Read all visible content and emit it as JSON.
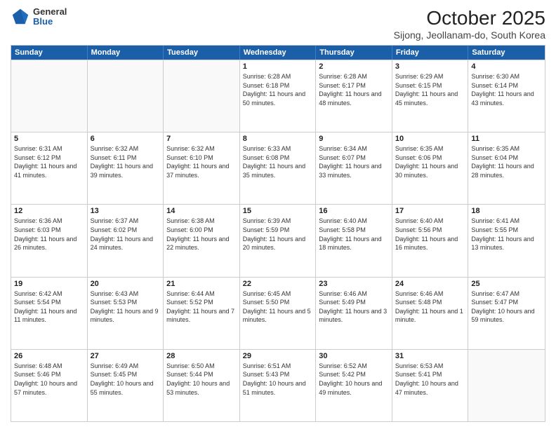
{
  "header": {
    "logo_general": "General",
    "logo_blue": "Blue",
    "title": "October 2025",
    "subtitle": "Sijong, Jeollanam-do, South Korea"
  },
  "weekdays": [
    "Sunday",
    "Monday",
    "Tuesday",
    "Wednesday",
    "Thursday",
    "Friday",
    "Saturday"
  ],
  "weeks": [
    [
      {
        "day": "",
        "sunrise": "",
        "sunset": "",
        "daylight": ""
      },
      {
        "day": "",
        "sunrise": "",
        "sunset": "",
        "daylight": ""
      },
      {
        "day": "",
        "sunrise": "",
        "sunset": "",
        "daylight": ""
      },
      {
        "day": "1",
        "sunrise": "Sunrise: 6:28 AM",
        "sunset": "Sunset: 6:18 PM",
        "daylight": "Daylight: 11 hours and 50 minutes."
      },
      {
        "day": "2",
        "sunrise": "Sunrise: 6:28 AM",
        "sunset": "Sunset: 6:17 PM",
        "daylight": "Daylight: 11 hours and 48 minutes."
      },
      {
        "day": "3",
        "sunrise": "Sunrise: 6:29 AM",
        "sunset": "Sunset: 6:15 PM",
        "daylight": "Daylight: 11 hours and 45 minutes."
      },
      {
        "day": "4",
        "sunrise": "Sunrise: 6:30 AM",
        "sunset": "Sunset: 6:14 PM",
        "daylight": "Daylight: 11 hours and 43 minutes."
      }
    ],
    [
      {
        "day": "5",
        "sunrise": "Sunrise: 6:31 AM",
        "sunset": "Sunset: 6:12 PM",
        "daylight": "Daylight: 11 hours and 41 minutes."
      },
      {
        "day": "6",
        "sunrise": "Sunrise: 6:32 AM",
        "sunset": "Sunset: 6:11 PM",
        "daylight": "Daylight: 11 hours and 39 minutes."
      },
      {
        "day": "7",
        "sunrise": "Sunrise: 6:32 AM",
        "sunset": "Sunset: 6:10 PM",
        "daylight": "Daylight: 11 hours and 37 minutes."
      },
      {
        "day": "8",
        "sunrise": "Sunrise: 6:33 AM",
        "sunset": "Sunset: 6:08 PM",
        "daylight": "Daylight: 11 hours and 35 minutes."
      },
      {
        "day": "9",
        "sunrise": "Sunrise: 6:34 AM",
        "sunset": "Sunset: 6:07 PM",
        "daylight": "Daylight: 11 hours and 33 minutes."
      },
      {
        "day": "10",
        "sunrise": "Sunrise: 6:35 AM",
        "sunset": "Sunset: 6:06 PM",
        "daylight": "Daylight: 11 hours and 30 minutes."
      },
      {
        "day": "11",
        "sunrise": "Sunrise: 6:35 AM",
        "sunset": "Sunset: 6:04 PM",
        "daylight": "Daylight: 11 hours and 28 minutes."
      }
    ],
    [
      {
        "day": "12",
        "sunrise": "Sunrise: 6:36 AM",
        "sunset": "Sunset: 6:03 PM",
        "daylight": "Daylight: 11 hours and 26 minutes."
      },
      {
        "day": "13",
        "sunrise": "Sunrise: 6:37 AM",
        "sunset": "Sunset: 6:02 PM",
        "daylight": "Daylight: 11 hours and 24 minutes."
      },
      {
        "day": "14",
        "sunrise": "Sunrise: 6:38 AM",
        "sunset": "Sunset: 6:00 PM",
        "daylight": "Daylight: 11 hours and 22 minutes."
      },
      {
        "day": "15",
        "sunrise": "Sunrise: 6:39 AM",
        "sunset": "Sunset: 5:59 PM",
        "daylight": "Daylight: 11 hours and 20 minutes."
      },
      {
        "day": "16",
        "sunrise": "Sunrise: 6:40 AM",
        "sunset": "Sunset: 5:58 PM",
        "daylight": "Daylight: 11 hours and 18 minutes."
      },
      {
        "day": "17",
        "sunrise": "Sunrise: 6:40 AM",
        "sunset": "Sunset: 5:56 PM",
        "daylight": "Daylight: 11 hours and 16 minutes."
      },
      {
        "day": "18",
        "sunrise": "Sunrise: 6:41 AM",
        "sunset": "Sunset: 5:55 PM",
        "daylight": "Daylight: 11 hours and 13 minutes."
      }
    ],
    [
      {
        "day": "19",
        "sunrise": "Sunrise: 6:42 AM",
        "sunset": "Sunset: 5:54 PM",
        "daylight": "Daylight: 11 hours and 11 minutes."
      },
      {
        "day": "20",
        "sunrise": "Sunrise: 6:43 AM",
        "sunset": "Sunset: 5:53 PM",
        "daylight": "Daylight: 11 hours and 9 minutes."
      },
      {
        "day": "21",
        "sunrise": "Sunrise: 6:44 AM",
        "sunset": "Sunset: 5:52 PM",
        "daylight": "Daylight: 11 hours and 7 minutes."
      },
      {
        "day": "22",
        "sunrise": "Sunrise: 6:45 AM",
        "sunset": "Sunset: 5:50 PM",
        "daylight": "Daylight: 11 hours and 5 minutes."
      },
      {
        "day": "23",
        "sunrise": "Sunrise: 6:46 AM",
        "sunset": "Sunset: 5:49 PM",
        "daylight": "Daylight: 11 hours and 3 minutes."
      },
      {
        "day": "24",
        "sunrise": "Sunrise: 6:46 AM",
        "sunset": "Sunset: 5:48 PM",
        "daylight": "Daylight: 11 hours and 1 minute."
      },
      {
        "day": "25",
        "sunrise": "Sunrise: 6:47 AM",
        "sunset": "Sunset: 5:47 PM",
        "daylight": "Daylight: 10 hours and 59 minutes."
      }
    ],
    [
      {
        "day": "26",
        "sunrise": "Sunrise: 6:48 AM",
        "sunset": "Sunset: 5:46 PM",
        "daylight": "Daylight: 10 hours and 57 minutes."
      },
      {
        "day": "27",
        "sunrise": "Sunrise: 6:49 AM",
        "sunset": "Sunset: 5:45 PM",
        "daylight": "Daylight: 10 hours and 55 minutes."
      },
      {
        "day": "28",
        "sunrise": "Sunrise: 6:50 AM",
        "sunset": "Sunset: 5:44 PM",
        "daylight": "Daylight: 10 hours and 53 minutes."
      },
      {
        "day": "29",
        "sunrise": "Sunrise: 6:51 AM",
        "sunset": "Sunset: 5:43 PM",
        "daylight": "Daylight: 10 hours and 51 minutes."
      },
      {
        "day": "30",
        "sunrise": "Sunrise: 6:52 AM",
        "sunset": "Sunset: 5:42 PM",
        "daylight": "Daylight: 10 hours and 49 minutes."
      },
      {
        "day": "31",
        "sunrise": "Sunrise: 6:53 AM",
        "sunset": "Sunset: 5:41 PM",
        "daylight": "Daylight: 10 hours and 47 minutes."
      },
      {
        "day": "",
        "sunrise": "",
        "sunset": "",
        "daylight": ""
      }
    ]
  ]
}
